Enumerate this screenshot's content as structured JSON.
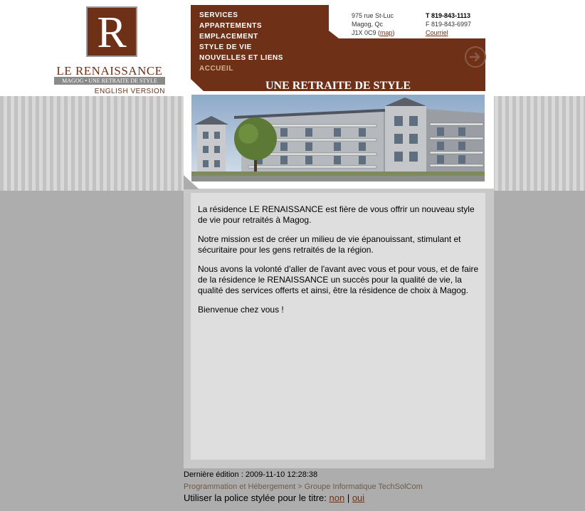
{
  "colors": {
    "brand": "#6e3118",
    "page_bg": "#adadad",
    "content_bg": "#dedede"
  },
  "logo": {
    "letter": "R",
    "name": "LE RENAISSANCE",
    "tagline": "MAGOG • UNE RETRAITE DE STYLE",
    "english_link": "ENGLISH VERSION"
  },
  "nav": {
    "items": [
      "SERVICES",
      "APPARTEMENTS",
      "EMPLACEMENT",
      "STYLE DE VIE",
      "NOUVELLES ET LIENS",
      "ACCUEIL"
    ],
    "current": "ACCUEIL"
  },
  "address": {
    "line1": "975 rue St-Luc",
    "line2": "Magog, Qc",
    "postal": "J1X 0C9",
    "map_label": "map"
  },
  "contact": {
    "phone": "T 819-843-1113",
    "fax": "F 819-843-6997",
    "email_label": "Courriel"
  },
  "icons": {
    "next": "arrow-right-circle-icon"
  },
  "slogan": "UNE RETRAITE DE STYLE",
  "content": {
    "paragraphs": [
      "La résidence LE RENAISSANCE est fière de vous offrir un nouveau style de vie pour retraités à Magog.",
      "Notre mission est de créer un milieu de vie épanouissant, stimulant et sécuritaire pour les  gens retraités de la région.",
      "Nous avons la volonté d'aller de l'avant avec vous et pour vous, et de faire de la résidence le RENAISSANCE un succès pour la qualité de vie, la qualité des services offerts et ainsi, être la résidence de choix à Magog.",
      "Bienvenue chez vous !"
    ]
  },
  "footer": {
    "last_edit": "Dernière édition : 2009-11-10 12:28:38",
    "programming": "Programmation et Hébergement > Groupe Informatique TechSolCom",
    "font_prompt": "Utiliser la police stylée pour le titre:",
    "opt_no": "non",
    "separator": "|",
    "opt_yes": "oui"
  }
}
